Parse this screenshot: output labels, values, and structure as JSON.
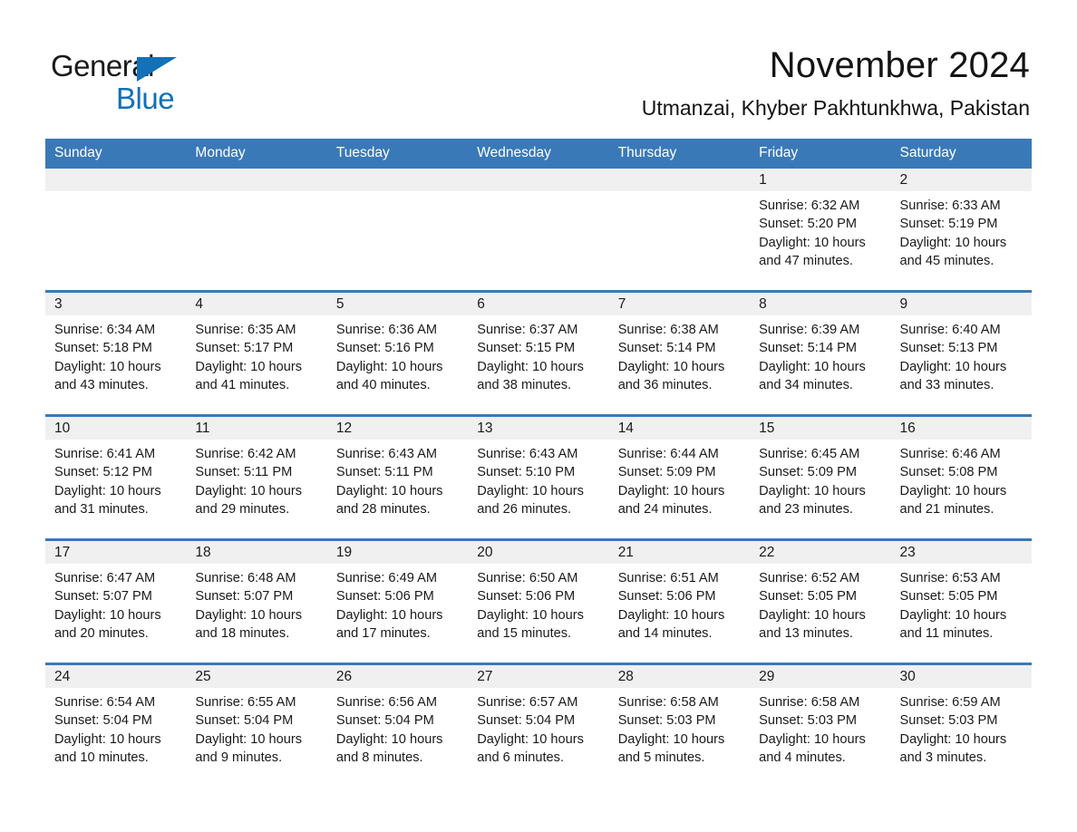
{
  "logo": {
    "word_one": "General",
    "word_two": "Blue",
    "triangle_icon": "triangle-icon",
    "brand_color": "#1271b8"
  },
  "header": {
    "month_title": "November 2024",
    "location": "Utmanzai, Khyber Pakhtunkhwa, Pakistan",
    "header_bg_color": "#3a79b8",
    "band_bg_color": "#f0f0f0"
  },
  "calendar": {
    "weekday_headers": [
      "Sunday",
      "Monday",
      "Tuesday",
      "Wednesday",
      "Thursday",
      "Friday",
      "Saturday"
    ],
    "weeks": [
      [
        {
          "day": "",
          "info": ""
        },
        {
          "day": "",
          "info": ""
        },
        {
          "day": "",
          "info": ""
        },
        {
          "day": "",
          "info": ""
        },
        {
          "day": "",
          "info": ""
        },
        {
          "day": "1",
          "info": "Sunrise: 6:32 AM\nSunset: 5:20 PM\nDaylight: 10 hours\nand 47 minutes."
        },
        {
          "day": "2",
          "info": "Sunrise: 6:33 AM\nSunset: 5:19 PM\nDaylight: 10 hours\nand 45 minutes."
        }
      ],
      [
        {
          "day": "3",
          "info": "Sunrise: 6:34 AM\nSunset: 5:18 PM\nDaylight: 10 hours\nand 43 minutes."
        },
        {
          "day": "4",
          "info": "Sunrise: 6:35 AM\nSunset: 5:17 PM\nDaylight: 10 hours\nand 41 minutes."
        },
        {
          "day": "5",
          "info": "Sunrise: 6:36 AM\nSunset: 5:16 PM\nDaylight: 10 hours\nand 40 minutes."
        },
        {
          "day": "6",
          "info": "Sunrise: 6:37 AM\nSunset: 5:15 PM\nDaylight: 10 hours\nand 38 minutes."
        },
        {
          "day": "7",
          "info": "Sunrise: 6:38 AM\nSunset: 5:14 PM\nDaylight: 10 hours\nand 36 minutes."
        },
        {
          "day": "8",
          "info": "Sunrise: 6:39 AM\nSunset: 5:14 PM\nDaylight: 10 hours\nand 34 minutes."
        },
        {
          "day": "9",
          "info": "Sunrise: 6:40 AM\nSunset: 5:13 PM\nDaylight: 10 hours\nand 33 minutes."
        }
      ],
      [
        {
          "day": "10",
          "info": "Sunrise: 6:41 AM\nSunset: 5:12 PM\nDaylight: 10 hours\nand 31 minutes."
        },
        {
          "day": "11",
          "info": "Sunrise: 6:42 AM\nSunset: 5:11 PM\nDaylight: 10 hours\nand 29 minutes."
        },
        {
          "day": "12",
          "info": "Sunrise: 6:43 AM\nSunset: 5:11 PM\nDaylight: 10 hours\nand 28 minutes."
        },
        {
          "day": "13",
          "info": "Sunrise: 6:43 AM\nSunset: 5:10 PM\nDaylight: 10 hours\nand 26 minutes."
        },
        {
          "day": "14",
          "info": "Sunrise: 6:44 AM\nSunset: 5:09 PM\nDaylight: 10 hours\nand 24 minutes."
        },
        {
          "day": "15",
          "info": "Sunrise: 6:45 AM\nSunset: 5:09 PM\nDaylight: 10 hours\nand 23 minutes."
        },
        {
          "day": "16",
          "info": "Sunrise: 6:46 AM\nSunset: 5:08 PM\nDaylight: 10 hours\nand 21 minutes."
        }
      ],
      [
        {
          "day": "17",
          "info": "Sunrise: 6:47 AM\nSunset: 5:07 PM\nDaylight: 10 hours\nand 20 minutes."
        },
        {
          "day": "18",
          "info": "Sunrise: 6:48 AM\nSunset: 5:07 PM\nDaylight: 10 hours\nand 18 minutes."
        },
        {
          "day": "19",
          "info": "Sunrise: 6:49 AM\nSunset: 5:06 PM\nDaylight: 10 hours\nand 17 minutes."
        },
        {
          "day": "20",
          "info": "Sunrise: 6:50 AM\nSunset: 5:06 PM\nDaylight: 10 hours\nand 15 minutes."
        },
        {
          "day": "21",
          "info": "Sunrise: 6:51 AM\nSunset: 5:06 PM\nDaylight: 10 hours\nand 14 minutes."
        },
        {
          "day": "22",
          "info": "Sunrise: 6:52 AM\nSunset: 5:05 PM\nDaylight: 10 hours\nand 13 minutes."
        },
        {
          "day": "23",
          "info": "Sunrise: 6:53 AM\nSunset: 5:05 PM\nDaylight: 10 hours\nand 11 minutes."
        }
      ],
      [
        {
          "day": "24",
          "info": "Sunrise: 6:54 AM\nSunset: 5:04 PM\nDaylight: 10 hours\nand 10 minutes."
        },
        {
          "day": "25",
          "info": "Sunrise: 6:55 AM\nSunset: 5:04 PM\nDaylight: 10 hours\nand 9 minutes."
        },
        {
          "day": "26",
          "info": "Sunrise: 6:56 AM\nSunset: 5:04 PM\nDaylight: 10 hours\nand 8 minutes."
        },
        {
          "day": "27",
          "info": "Sunrise: 6:57 AM\nSunset: 5:04 PM\nDaylight: 10 hours\nand 6 minutes."
        },
        {
          "day": "28",
          "info": "Sunrise: 6:58 AM\nSunset: 5:03 PM\nDaylight: 10 hours\nand 5 minutes."
        },
        {
          "day": "29",
          "info": "Sunrise: 6:58 AM\nSunset: 5:03 PM\nDaylight: 10 hours\nand 4 minutes."
        },
        {
          "day": "30",
          "info": "Sunrise: 6:59 AM\nSunset: 5:03 PM\nDaylight: 10 hours\nand 3 minutes."
        }
      ]
    ]
  }
}
